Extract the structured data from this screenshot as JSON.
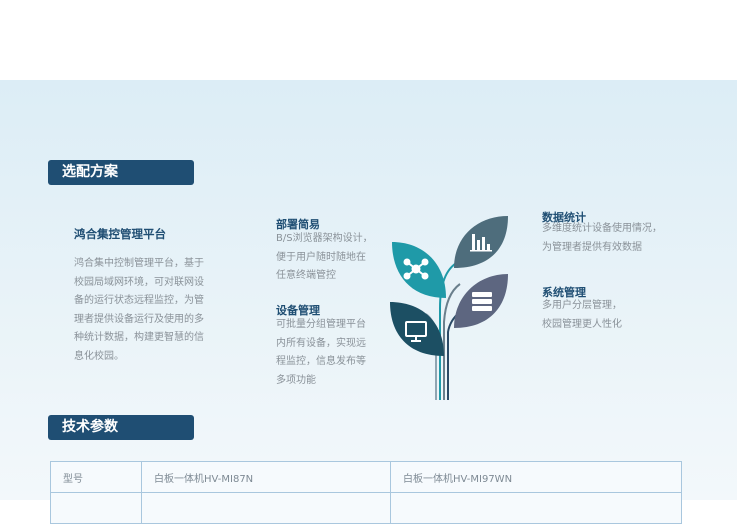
{
  "section_config": {
    "title": "选配方案"
  },
  "platform": {
    "title": "鸿合集控管理平台",
    "lines": [
      "鸿合集中控制管理平台，基于",
      "校园局域网环境，可对联网设",
      "备的运行状态远程监控，为管",
      "理者提供设备运行及使用的多",
      "种统计数据，构建更智慧的信",
      "息化校园。"
    ]
  },
  "features": {
    "deploy": {
      "title": "部署简易",
      "lines": [
        "B/S浏览器架构设计，",
        "便于用户随时随地在",
        "任意终端管控"
      ]
    },
    "device": {
      "title": "设备管理",
      "lines": [
        "可批量分组管理平台",
        "内所有设备，实现远",
        "程监控，信息发布等",
        "多项功能"
      ]
    },
    "stats": {
      "title": "数据统计",
      "lines": [
        "多维度统计设备使用情况，",
        "为管理者提供有效数据"
      ]
    },
    "system": {
      "title": "系统管理",
      "lines": [
        "多用户分层管理，",
        "校园管理更人性化"
      ]
    }
  },
  "icons": {
    "network": "network-icon",
    "monitor": "monitor-icon",
    "chart": "bar-chart-icon",
    "server": "server-icon"
  },
  "colors": {
    "teal": "#1f9aa8",
    "dark_teal": "#1c4f63",
    "slate": "#4e6d7c",
    "gray_blue": "#5d6680",
    "tab": "#1f4e73"
  },
  "section_tech": {
    "title": "技术参数"
  },
  "tech_table": {
    "rows": [
      {
        "label": "型号",
        "col1": "白板一体机HV-MI87N",
        "col2": "白板一体机HV-MI97WN"
      },
      {
        "label": "",
        "col1": "",
        "col2": ""
      }
    ]
  }
}
